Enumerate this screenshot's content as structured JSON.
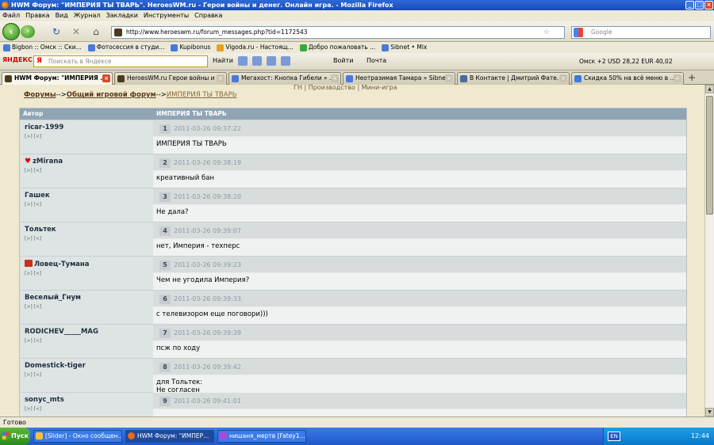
{
  "window": {
    "title": "HWM Форум: \"ИМПЕРИЯ ТЫ ТВАРЬ\". HeroesWM.ru - Герои войны и денег. Онлайн игра. - Mozilla Firefox"
  },
  "menu": [
    "Файл",
    "Правка",
    "Вид",
    "Журнал",
    "Закладки",
    "Инструменты",
    "Справка"
  ],
  "nav": {
    "url": "http://www.heroeswm.ru/forum_messages.php?tid=1172543",
    "search_placeholder": "Google"
  },
  "bookmarks": [
    "Bigbon :: Омск :: Ски...",
    "Фотосессия в студи...",
    "Kupibonus",
    "Vigoda.ru - Настоящ...",
    "Добро пожаловать ...",
    "Sibnet • Mix"
  ],
  "yandex": {
    "logo": "ЯНДЕКС",
    "placeholder": "Поискать в Яндексе",
    "find": "Найти",
    "login": "Войти",
    "mail": "Почта",
    "weather": "Омск  +2  USD 28,22  EUR 40,02"
  },
  "tabs": [
    "HWM Форум: \"ИМПЕРИЯ ...",
    "HeroesWM.ru Герои войны и ...",
    "Мегахост: Кнопка Гибели » ...",
    "Неотразимая Тамара » Sibne...",
    "В Контакте | Дмитрий Фате...",
    "Скидка 50% на всё меню в ..."
  ],
  "page": {
    "topnav": "ГН | Производство | Мини-игра",
    "breadcrumb": {
      "forums": "Форумы",
      "sep1": "-->",
      "general": "Общий игровой форум",
      "sep2": "-->",
      "current": "ИМПЕРИЯ ТЫ ТВАРЬ"
    },
    "header": {
      "author": "Автор",
      "title": "ИМПЕРИЯ ТЫ ТВАРЬ"
    },
    "post_links": "[>]  [<]",
    "posts": [
      {
        "author": "ricar-1999",
        "num": "1",
        "date": "2011-03-26 09:37:22",
        "text": "ИМПЕРИЯ ТЫ ТВАРЬ",
        "badge": ""
      },
      {
        "author": "zMirana",
        "num": "2",
        "date": "2011-03-26 09:38:19",
        "text": "креативный бан",
        "badge": "heart"
      },
      {
        "author": "Гашек",
        "num": "3",
        "date": "2011-03-26 09:38:20",
        "text": "Не дала?",
        "badge": ""
      },
      {
        "author": "Тольтек",
        "num": "4",
        "date": "2011-03-26 09:39:07",
        "text": "нет, Империя - техперс",
        "badge": ""
      },
      {
        "author": "Ловец-Тумана",
        "num": "5",
        "date": "2011-03-26 09:39:23",
        "text": "Чем не угодила Империя?",
        "badge": "flag"
      },
      {
        "author": "Веселый_Гнум",
        "num": "6",
        "date": "2011-03-26 09:39:33",
        "text": "с телевизором еще поговори)))",
        "badge": ""
      },
      {
        "author": "RODICHEV_____MAG",
        "num": "7",
        "date": "2011-03-26 09:39:39",
        "text": "псж по ходу",
        "badge": ""
      },
      {
        "author": "Domestick-tiger",
        "num": "8",
        "date": "2011-03-26 09:39:42",
        "text": "для Тольтек:\nНе согласен",
        "badge": ""
      },
      {
        "author": "sonyc_mts",
        "num": "9",
        "date": "2011-03-26 09:41:01",
        "text": "",
        "badge": ""
      }
    ]
  },
  "status": "Готово",
  "taskbar": {
    "start": "Пуск",
    "items": [
      "[Slider] - Окно сообщен...",
      "HWM Форум: \"ИМПЕР...",
      "нишаня_мертв [Fatey1..."
    ],
    "lang": "EN",
    "time": "12:44"
  }
}
